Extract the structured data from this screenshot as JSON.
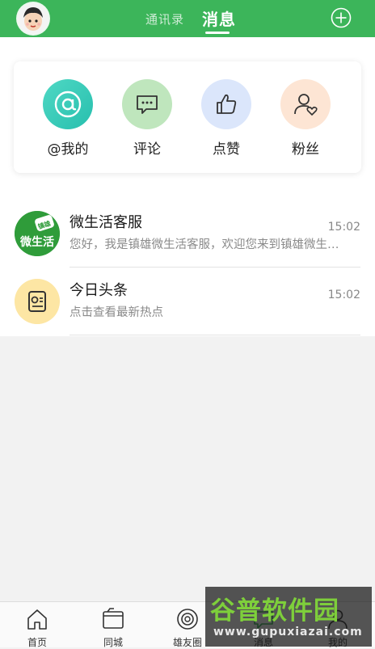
{
  "header": {
    "tabs": [
      {
        "label": "通讯录",
        "active": false
      },
      {
        "label": "消息",
        "active": true
      }
    ]
  },
  "quick_actions": [
    {
      "label": "@我的",
      "icon": "at-icon",
      "color": "#33c9b8"
    },
    {
      "label": "评论",
      "icon": "comment-icon",
      "color": "#bfe6bd"
    },
    {
      "label": "点赞",
      "icon": "thumbs-up-icon",
      "color": "#dbe6fb"
    },
    {
      "label": "粉丝",
      "icon": "fans-icon",
      "color": "#fde5d4"
    }
  ],
  "messages": [
    {
      "title": "微生活客服",
      "preview": "您好，我是镇雄微生活客服，欢迎您来到镇雄微生活！",
      "time": "15:02",
      "avatar_text": "微生活",
      "avatar_badge": "镇雄"
    },
    {
      "title": "今日头条",
      "preview": "点击查看最新热点",
      "time": "15:02"
    }
  ],
  "bottom_nav": [
    {
      "label": "首页",
      "icon": "home-icon"
    },
    {
      "label": "同城",
      "icon": "folder-icon"
    },
    {
      "label": "雄友圈",
      "icon": "circle-icon"
    },
    {
      "label": "消息",
      "icon": "message-icon"
    },
    {
      "label": "我的",
      "icon": "profile-icon"
    }
  ],
  "watermark": {
    "title": "谷普软件园",
    "url": "www.gupuxiazai.com"
  },
  "colors": {
    "brand_green": "#3cb55a",
    "background": "#f2f2f2"
  }
}
